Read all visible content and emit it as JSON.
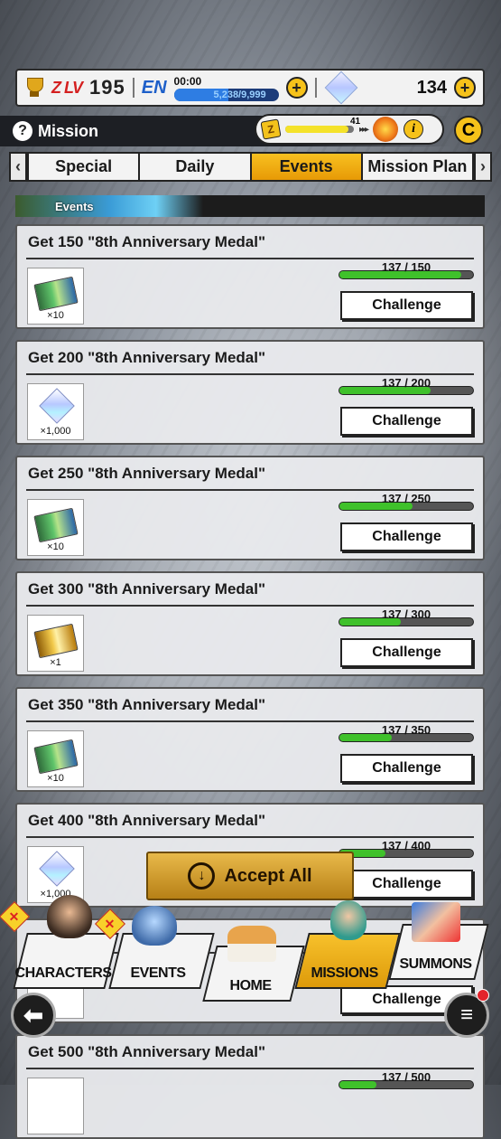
{
  "status": {
    "level_prefix": "Z LV",
    "level": "195",
    "energy_label": "EN",
    "energy_timer": "00:00",
    "energy_value": "5,238/9,999",
    "crystals": "134"
  },
  "header": {
    "title": "Mission",
    "zbar_value": "41"
  },
  "tabs": [
    {
      "label": "Special"
    },
    {
      "label": "Daily"
    },
    {
      "label": "Events",
      "active": true
    },
    {
      "label": "Mission Plan"
    }
  ],
  "section_label": "Events",
  "missions": [
    {
      "title": "Get 150 \"8th Anniversary Medal\"",
      "reward_qty": "×10",
      "reward_icon": "ticket-icon",
      "progress": "137 / 150",
      "progress_fraction": 0.913,
      "button": "Challenge"
    },
    {
      "title": "Get 200 \"8th Anniversary Medal\"",
      "reward_qty": "×1,000",
      "reward_icon": "crystal-icon",
      "progress": "137 / 200",
      "progress_fraction": 0.685,
      "button": "Challenge"
    },
    {
      "title": "Get 250 \"8th Anniversary Medal\"",
      "reward_qty": "×10",
      "reward_icon": "ticket-icon",
      "progress": "137 / 250",
      "progress_fraction": 0.548,
      "button": "Challenge"
    },
    {
      "title": "Get 300 \"8th Anniversary Medal\"",
      "reward_qty": "×1",
      "reward_icon": "gold-ticket-icon",
      "progress": "137 / 300",
      "progress_fraction": 0.457,
      "button": "Challenge"
    },
    {
      "title": "Get 350 \"8th Anniversary Medal\"",
      "reward_qty": "×10",
      "reward_icon": "ticket-icon",
      "progress": "137 / 350",
      "progress_fraction": 0.391,
      "button": "Challenge"
    },
    {
      "title": "Get 400 \"8th Anniversary Medal\"",
      "reward_qty": "×1,000",
      "reward_icon": "crystal-icon",
      "progress": "137 / 400",
      "progress_fraction": 0.343,
      "button": "Challenge"
    },
    {
      "title": "",
      "reward_qty": "",
      "reward_icon": "",
      "progress": "",
      "progress_fraction": 0.3,
      "button": "Challenge"
    },
    {
      "title": "Get 500 \"8th Anniversary Medal\"",
      "reward_qty": "",
      "reward_icon": "",
      "progress": "137 / 500",
      "progress_fraction": 0.274,
      "button": ""
    }
  ],
  "accept_all": "Accept All",
  "nav": {
    "characters": "CHARACTERS",
    "events": "EVENTS",
    "home": "HOME",
    "missions": "MISSIONS",
    "summons": "SUMMONS"
  },
  "badge_mark": "✕",
  "colors": {
    "accent": "#f6c21a",
    "progress": "#3fc12b",
    "energy": "#2e7de3"
  }
}
